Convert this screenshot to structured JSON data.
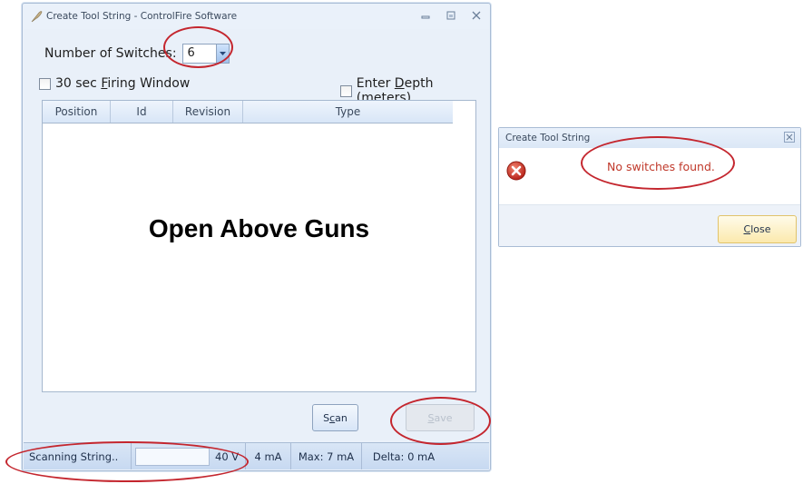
{
  "main_window": {
    "title": "Create Tool String - ControlFire Software",
    "num_switches_label": "Number of Switches:",
    "num_switches_value": "6",
    "firing_window_label_prefix": "30 sec ",
    "firing_window_label_access": "F",
    "firing_window_label_suffix": "iring Window",
    "enter_depth_label_prefix": "Enter ",
    "enter_depth_label_access": "D",
    "enter_depth_label_suffix": "epth (meters)",
    "grid": {
      "columns": [
        "Position",
        "Id",
        "Revision",
        "Type"
      ],
      "rows": [],
      "overlay_text": "Open Above Guns"
    },
    "scan_prefix": "S",
    "scan_access": "c",
    "scan_suffix": "an",
    "save_access": "S",
    "save_suffix": "ave",
    "status": {
      "scanning": "Scanning String..",
      "voltage": "40 V",
      "current": "4 mA",
      "max": "Max: 7 mA",
      "delta": "Delta: 0 mA"
    }
  },
  "dialog": {
    "title": "Create Tool String",
    "message": "No switches found.",
    "close_access": "C",
    "close_suffix": "lose"
  },
  "colors": {
    "annotation": "#c4262e",
    "error_icon": "#d9382b",
    "message_text": "#c0392b"
  }
}
